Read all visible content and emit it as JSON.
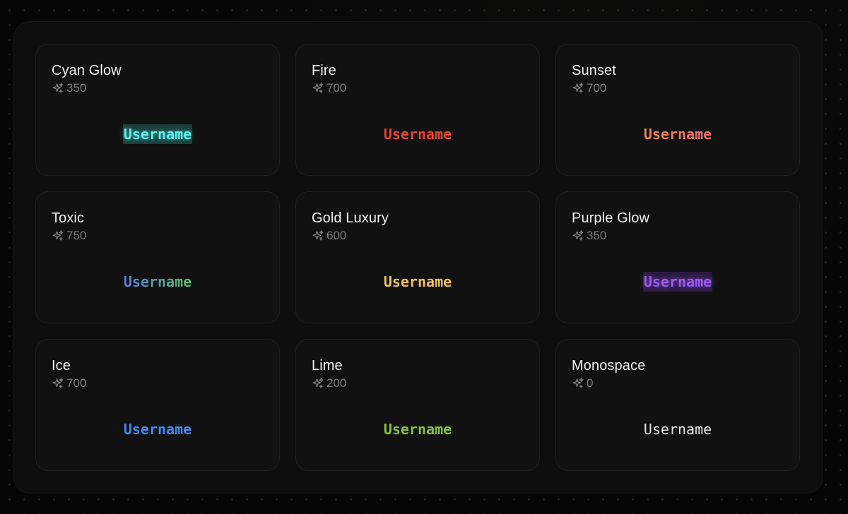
{
  "cards": [
    {
      "title": "Cyan Glow",
      "price": "350",
      "preview": "Username",
      "style": "cyan",
      "color": "#5ef0ec"
    },
    {
      "title": "Fire",
      "price": "700",
      "preview": "Username",
      "style": "fire",
      "color": "#e8452d"
    },
    {
      "title": "Sunset",
      "price": "700",
      "preview": "Username",
      "style": "sunset",
      "color": "#f08a4b"
    },
    {
      "title": "Toxic",
      "price": "750",
      "preview": "Username",
      "style": "toxic",
      "color": "#57c06a"
    },
    {
      "title": "Gold Luxury",
      "price": "600",
      "preview": "Username",
      "style": "gold",
      "color": "#f2c25a"
    },
    {
      "title": "Purple Glow",
      "price": "350",
      "preview": "Username",
      "style": "purple",
      "color": "#9b5cf0"
    },
    {
      "title": "Ice",
      "price": "700",
      "preview": "Username",
      "style": "ice",
      "color": "#3f8cf0"
    },
    {
      "title": "Lime",
      "price": "200",
      "preview": "Username",
      "style": "lime",
      "color": "#86c43c"
    },
    {
      "title": "Monospace",
      "price": "0",
      "preview": "Username",
      "style": "mono",
      "color": "#e8e8e8"
    }
  ],
  "icons": {
    "price": "sparkle-icon"
  }
}
